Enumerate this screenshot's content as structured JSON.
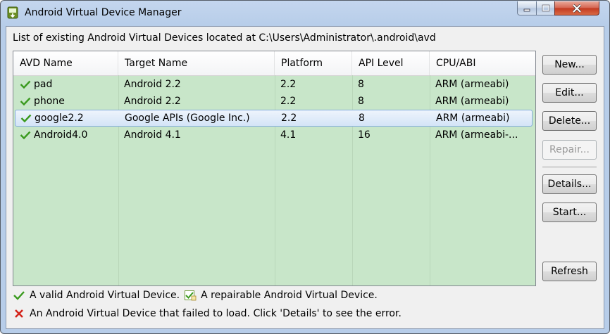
{
  "window": {
    "title": "Android Virtual Device Manager",
    "minimize_glyph": "▁",
    "maximize_glyph": "□",
    "close_glyph": "✕"
  },
  "path_label": "List of existing Android Virtual Devices located at C:\\Users\\Administrator\\.android\\avd",
  "table": {
    "columns": [
      "AVD Name",
      "Target Name",
      "Platform",
      "API Level",
      "CPU/ABI"
    ],
    "rows": [
      {
        "name": "pad",
        "target": "Android 2.2",
        "platform": "2.2",
        "api": "8",
        "cpu": "ARM (armeabi)",
        "status": "valid"
      },
      {
        "name": "phone",
        "target": "Android 2.2",
        "platform": "2.2",
        "api": "8",
        "cpu": "ARM (armeabi)",
        "status": "valid"
      },
      {
        "name": "google2.2",
        "target": "Google APIs (Google Inc.)",
        "platform": "2.2",
        "api": "8",
        "cpu": "ARM (armeabi)",
        "status": "valid",
        "selected": true
      },
      {
        "name": "Android4.0",
        "target": "Android 4.1",
        "platform": "4.1",
        "api": "16",
        "cpu": "ARM (armeabi-...",
        "status": "valid"
      }
    ]
  },
  "buttons": {
    "new": "New...",
    "edit": "Edit...",
    "delete": "Delete...",
    "repair": "Repair...",
    "details": "Details...",
    "start": "Start...",
    "refresh": "Refresh"
  },
  "legend": {
    "valid": "A valid Android Virtual Device.",
    "repairable": "A repairable Android Virtual Device.",
    "failed": "An Android Virtual Device that failed to load. Click 'Details' to see the error."
  },
  "colors": {
    "row_background": "#c8e6c9",
    "check_green": "#3a9a1e",
    "error_red": "#d4251c",
    "selection_border": "#84acdd"
  }
}
